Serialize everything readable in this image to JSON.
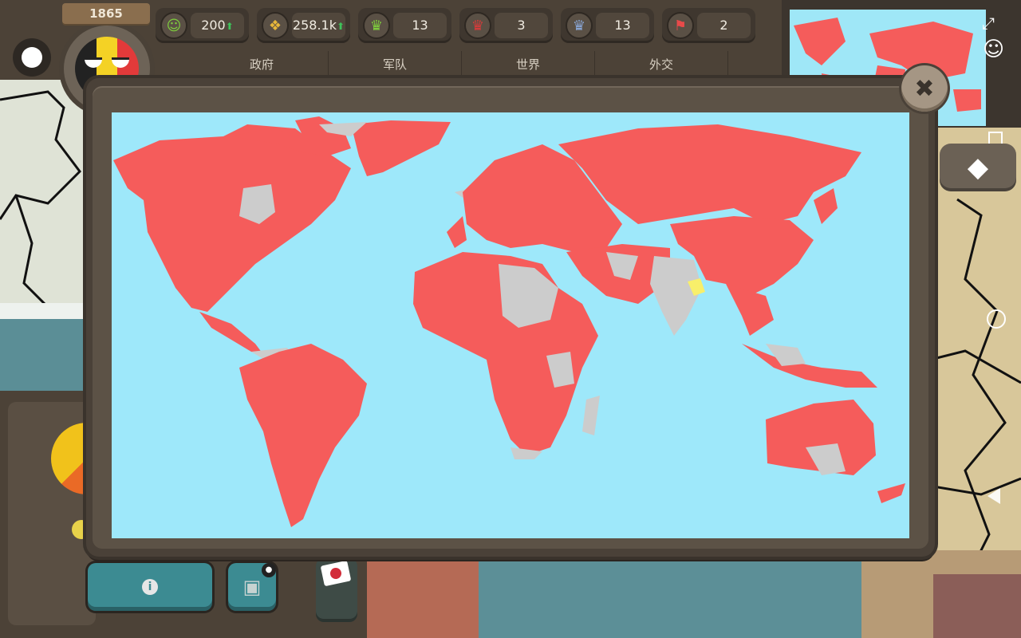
{
  "header": {
    "year": "1865",
    "resources": [
      {
        "name": "happiness",
        "icon": "smiley-icon",
        "value": "200",
        "trend": "up"
      },
      {
        "name": "money",
        "icon": "coins-icon",
        "value": "258.1k",
        "trend": "up"
      },
      {
        "name": "green-crown",
        "icon": "crown-green-icon",
        "value": "13",
        "trend": ""
      },
      {
        "name": "red-crown",
        "icon": "crown-red-icon",
        "value": "3",
        "trend": ""
      },
      {
        "name": "blue-crown",
        "icon": "crown-blue-icon",
        "value": "13",
        "trend": ""
      },
      {
        "name": "flags",
        "icon": "flag-icon",
        "value": "2",
        "trend": ""
      }
    ],
    "tabs": [
      {
        "label": "政府"
      },
      {
        "label": "军队"
      },
      {
        "label": "世界"
      },
      {
        "label": "外交"
      }
    ]
  },
  "colors": {
    "owned": "#f55c5b",
    "other": "#cccccc",
    "player": "#f8ef6a",
    "ocean": "#9ee8fa"
  },
  "modal": {
    "type": "world-map",
    "close_icon": "close-icon"
  },
  "side_icons": [
    "expand-icon",
    "person-icon",
    "square-icon",
    "gem-icon",
    "circle-icon",
    "back-icon"
  ],
  "bottom_panel": {
    "info_icon": "i"
  }
}
